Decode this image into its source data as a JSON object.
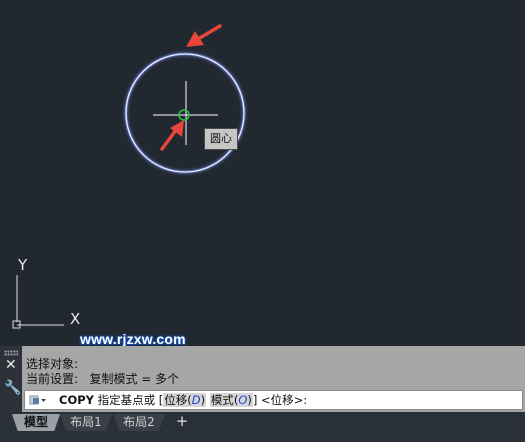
{
  "canvas": {
    "tooltip": "圆心",
    "watermark": "www.rjzxw.com",
    "ucs": {
      "y_label": "Y",
      "x_label": "X"
    }
  },
  "command_line": {
    "history": [
      "选择对象:",
      "当前设置:   复制模式 = 多个"
    ],
    "input": {
      "command": "COPY",
      "prompt": "指定基点或",
      "open_bracket": "[",
      "option1_label": "位移",
      "option1_key": "D",
      "option2_label": "模式",
      "option2_key": "O",
      "close_bracket": "]",
      "default": "<位移>:"
    },
    "close_icon": "close-icon",
    "customize_icon": "wrench-icon"
  },
  "tabs": [
    {
      "label": "模型",
      "active": true
    },
    {
      "label": "布局1",
      "active": false
    },
    {
      "label": "布局2",
      "active": false
    }
  ],
  "add_tab_label": "+",
  "colors": {
    "background": "#212830",
    "circle": "#d8e2ff",
    "arrow": "#e8453c",
    "osnap_marker": "#29c443"
  }
}
